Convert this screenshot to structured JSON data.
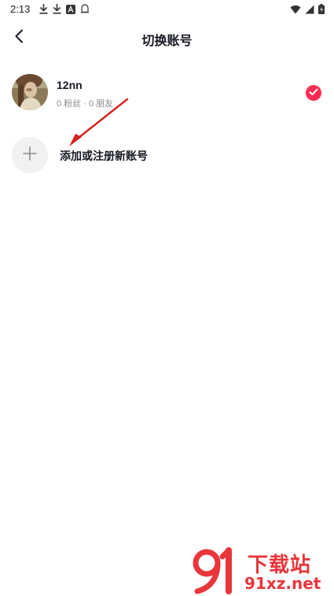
{
  "status_bar": {
    "time": "2:13",
    "left_icons": [
      "download-icon",
      "download-icon",
      "app-icon",
      "ghost-icon"
    ],
    "right_icons": [
      "wifi-icon",
      "signal-icon",
      "battery-icon"
    ]
  },
  "header": {
    "title": "切换账号"
  },
  "accounts": [
    {
      "name": "12nn",
      "stats": "0 粉丝 · 0 朋友",
      "selected": true
    }
  ],
  "add_account": {
    "label": "添加或注册新账号"
  },
  "watermark": {
    "brand": "下载站",
    "url": "91xz.net"
  },
  "colors": {
    "accent": "#fe2c55",
    "text_primary": "#161823",
    "text_secondary": "#8a8b91",
    "annotation_arrow": "#d42020"
  }
}
